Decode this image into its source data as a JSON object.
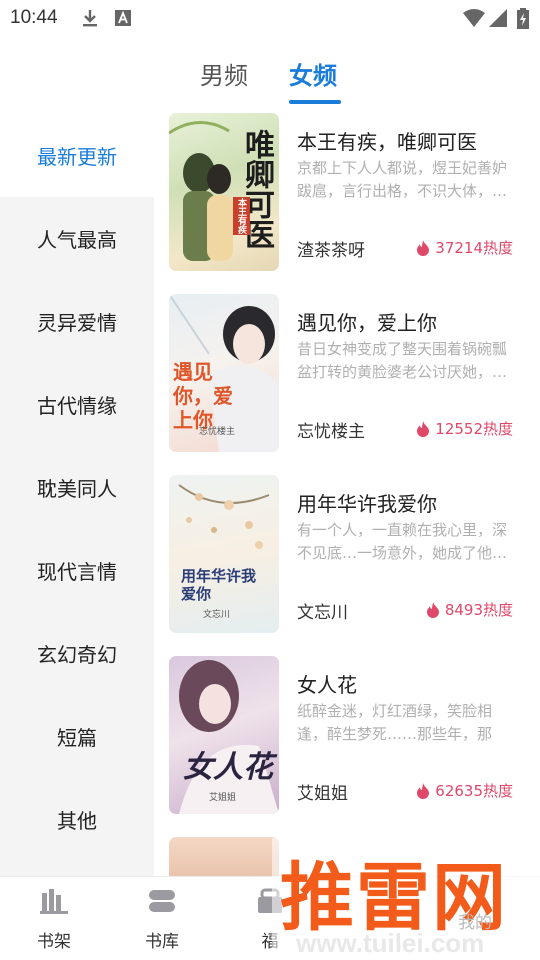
{
  "status_bar": {
    "time": "10:44",
    "icons": [
      "download-icon",
      "font-a-icon",
      "wifi-icon",
      "signal-icon",
      "battery-charging-icon"
    ]
  },
  "gender_tabs": [
    {
      "label": "男频",
      "active": false
    },
    {
      "label": "女频",
      "active": true
    }
  ],
  "categories": [
    {
      "label": "最新更新",
      "active": true
    },
    {
      "label": "人气最高",
      "active": false
    },
    {
      "label": "灵异爱情",
      "active": false
    },
    {
      "label": "古代情缘",
      "active": false
    },
    {
      "label": "耽美同人",
      "active": false
    },
    {
      "label": "现代言情",
      "active": false
    },
    {
      "label": "玄幻奇幻",
      "active": false
    },
    {
      "label": "短篇",
      "active": false
    },
    {
      "label": "其他",
      "active": false
    }
  ],
  "books": [
    {
      "title": "本王有疾，唯卿可医",
      "description": "京都上下人人都说，煜王妃善妒跋扈，言行出格，不识大体，…",
      "author": "渣茶茶呀",
      "heat": "37214热度",
      "cover_text": "唯卿可医",
      "cover_sub": "本王有疾"
    },
    {
      "title": "遇见你，爱上你",
      "description": "昔日女神变成了整天围着锅碗瓢盆打转的黄脸婆老公讨厌她，…",
      "author": "忘忧楼主",
      "heat": "12552热度",
      "cover_text": "遇见你，爱上你",
      "cover_sub": "忘忧楼主"
    },
    {
      "title": "用年华许我爱你",
      "description": "有一个人，一直赖在我心里，深不见底…一场意外，她成了他…",
      "author": "文忘川",
      "heat": "8493热度",
      "cover_text": "用年华许我爱你",
      "cover_sub": "文忘川"
    },
    {
      "title": "女人花",
      "description": "纸醉金迷，灯红酒绿，笑脸相逢，醉生梦死……那些年，那一…",
      "author": "艾姐姐",
      "heat": "62635热度",
      "cover_text": "女人花",
      "cover_sub": "艾姐姐"
    }
  ],
  "bottom_nav": [
    {
      "label": "书架",
      "icon": "bookshelf-icon"
    },
    {
      "label": "书库",
      "icon": "library-icon"
    },
    {
      "label": "福",
      "icon": "gift-icon"
    }
  ],
  "watermark": {
    "text": "推雷网",
    "url": "www.tuilei.com",
    "partial_label": "我的"
  },
  "colors": {
    "accent": "#1a7dd9",
    "heat": "#e0486a",
    "watermark": "#f25b1a"
  }
}
